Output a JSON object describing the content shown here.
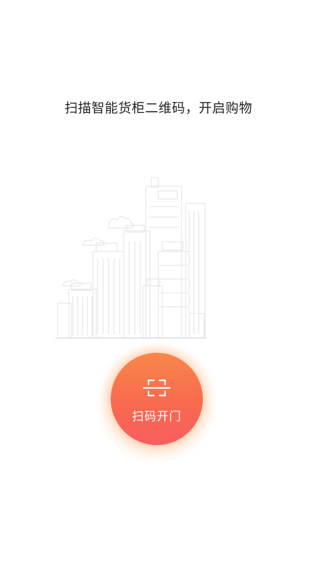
{
  "headline": "扫描智能货柜二维码，开启购物",
  "scan_button": {
    "label": "扫码开门",
    "icon": "scan-qr-icon",
    "gradient_top": "#f7874a",
    "gradient_bottom": "#f95d60"
  },
  "illustration": {
    "icon": "city-skyline-illustration",
    "stroke_color": "#e2e2e2"
  }
}
